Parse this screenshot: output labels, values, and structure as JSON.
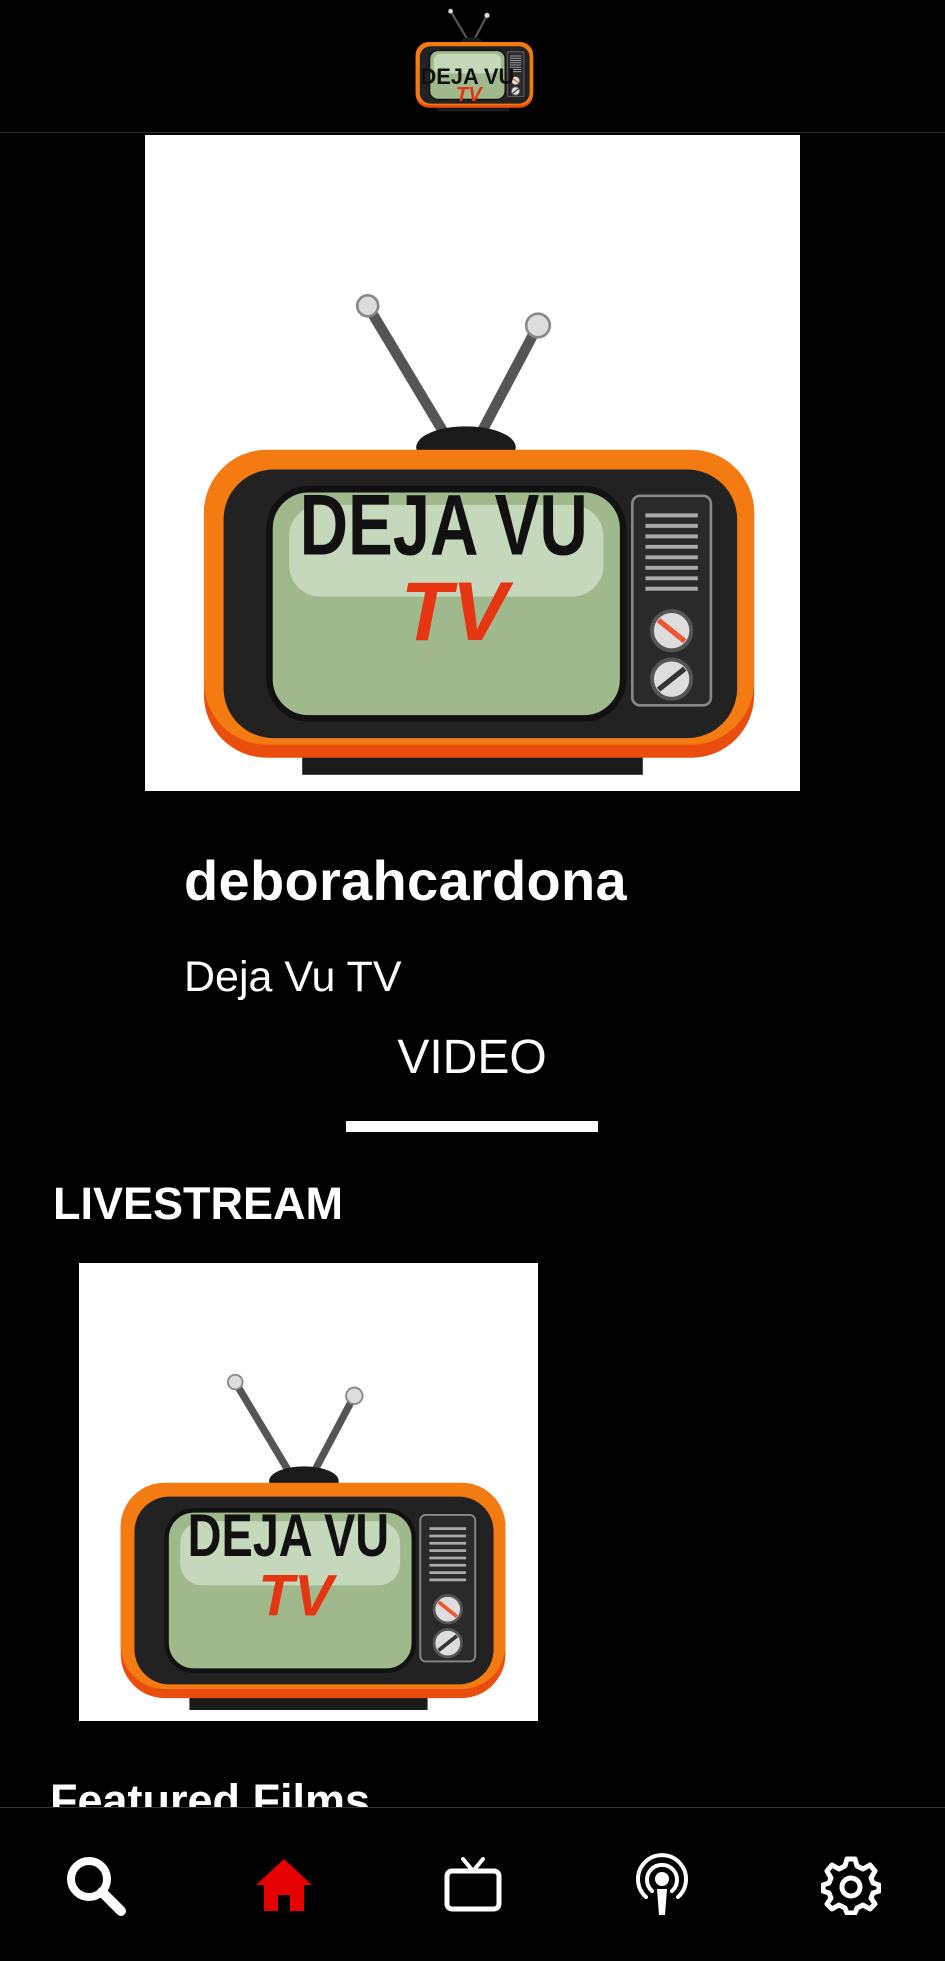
{
  "header": {
    "logo_icon": "deja-vu-tv-logo-icon"
  },
  "channel": {
    "name": "deborahcardona",
    "subtitle": "Deja Vu TV"
  },
  "tabs": [
    {
      "label": "VIDEO",
      "active": true
    }
  ],
  "sections": {
    "livestream_title": "LIVESTREAM",
    "featured_title": "Featured Films"
  },
  "logo_text": {
    "main": "DEJA VU",
    "sub": "TV"
  },
  "nav": [
    {
      "icon": "search-icon",
      "active": false
    },
    {
      "icon": "home-icon",
      "active": true
    },
    {
      "icon": "tv-icon",
      "active": false
    },
    {
      "icon": "podcast-icon",
      "active": false
    },
    {
      "icon": "gear-icon",
      "active": false
    }
  ],
  "colors": {
    "accent": "#e60000",
    "background": "#000000",
    "tv_orange": "#f06a10",
    "screen_green": "#a9c39a"
  }
}
